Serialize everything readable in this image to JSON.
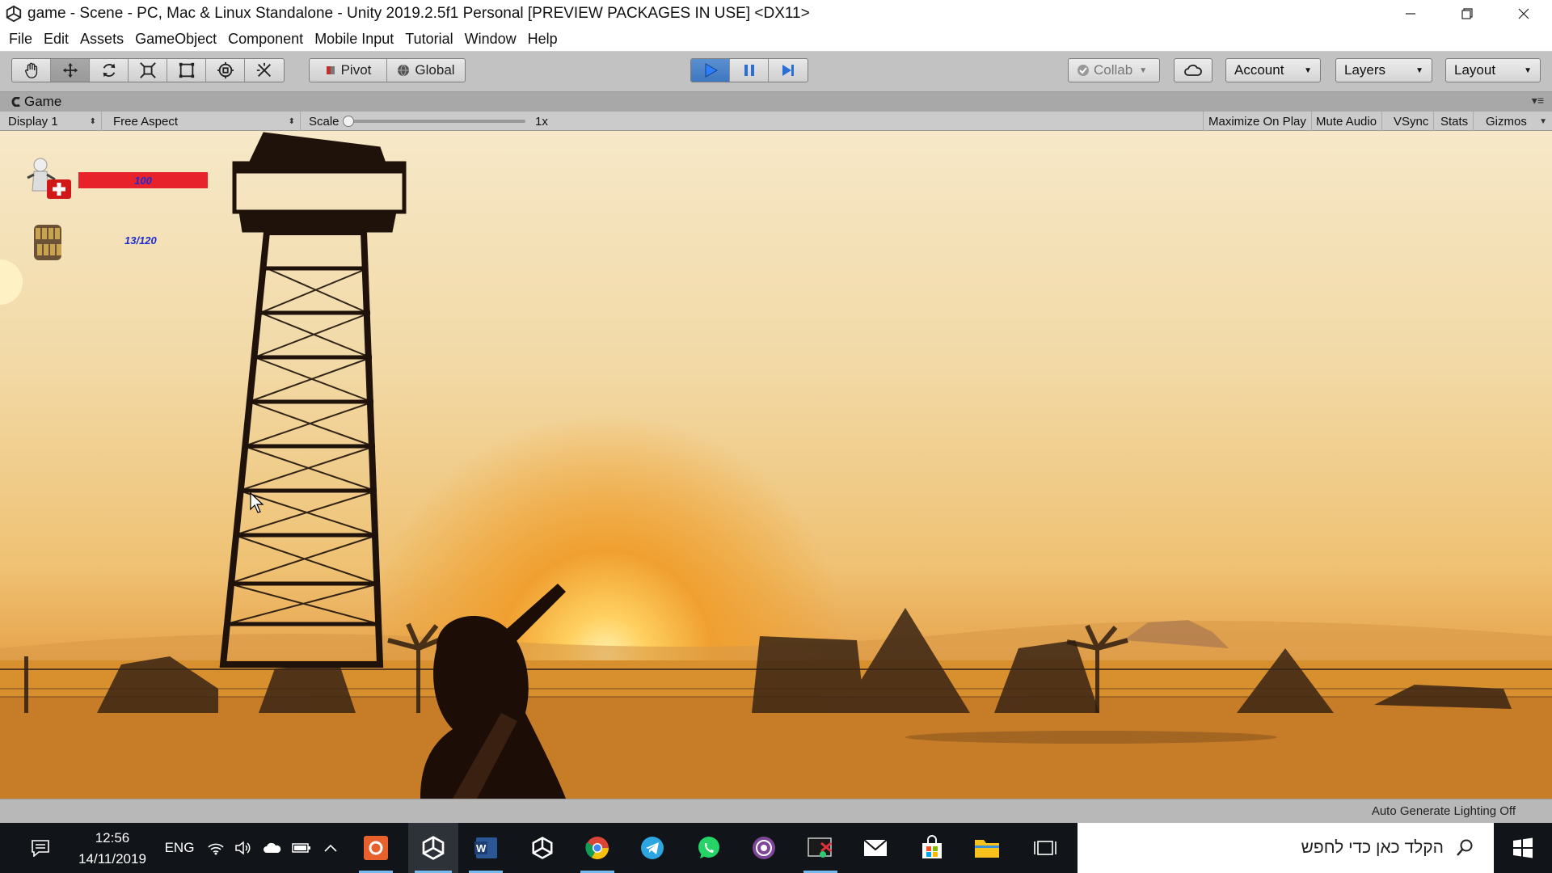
{
  "window": {
    "title": "game - Scene - PC, Mac & Linux Standalone - Unity 2019.2.5f1 Personal [PREVIEW PACKAGES IN USE] <DX11>",
    "minimize_icon": "minimize-icon",
    "restore_icon": "restore-icon",
    "close_icon": "close-icon"
  },
  "menu": {
    "items": [
      "File",
      "Edit",
      "Assets",
      "GameObject",
      "Component",
      "Mobile Input",
      "Tutorial",
      "Window",
      "Help"
    ]
  },
  "toolbar": {
    "tools": [
      "hand-tool",
      "move-tool",
      "rotate-tool",
      "scale-tool",
      "rect-tool",
      "transform-tool",
      "custom-tool"
    ],
    "active_tool": "move-tool",
    "pivot_label": "Pivot",
    "global_label": "Global",
    "play_state": "playing",
    "collab_label": "Collab",
    "account_label": "Account",
    "layers_label": "Layers",
    "layout_label": "Layout"
  },
  "game_tab": {
    "title": "Game"
  },
  "game_controls": {
    "display": "Display 1",
    "aspect": "Free Aspect",
    "scale_label": "Scale",
    "scale_value": "1x",
    "maximize_on_play": "Maximize On Play",
    "mute_audio": "Mute Audio",
    "vsync": "VSync",
    "stats": "Stats",
    "gizmos": "Gizmos"
  },
  "hud": {
    "health": "100",
    "ammo": "13/120"
  },
  "status": {
    "text": "Auto Generate Lighting Off"
  },
  "taskbar": {
    "time": "12:56",
    "date": "14/11/2019",
    "language": "ENG",
    "search_placeholder": "הקלד כאן כדי לחפש",
    "apps": [
      "screen-recorder",
      "unity",
      "word",
      "unity-hub",
      "chrome",
      "telegram",
      "whatsapp",
      "tor-browser",
      "snipping-tool",
      "mail",
      "store",
      "file-explorer",
      "task-view"
    ]
  },
  "colors": {
    "toolbar_bg": "#c2c2c2",
    "play_active": "#3f77c1",
    "health_bar": "#e8222a",
    "hud_text": "#1d2bd0",
    "taskbar_bg": "#111418"
  }
}
